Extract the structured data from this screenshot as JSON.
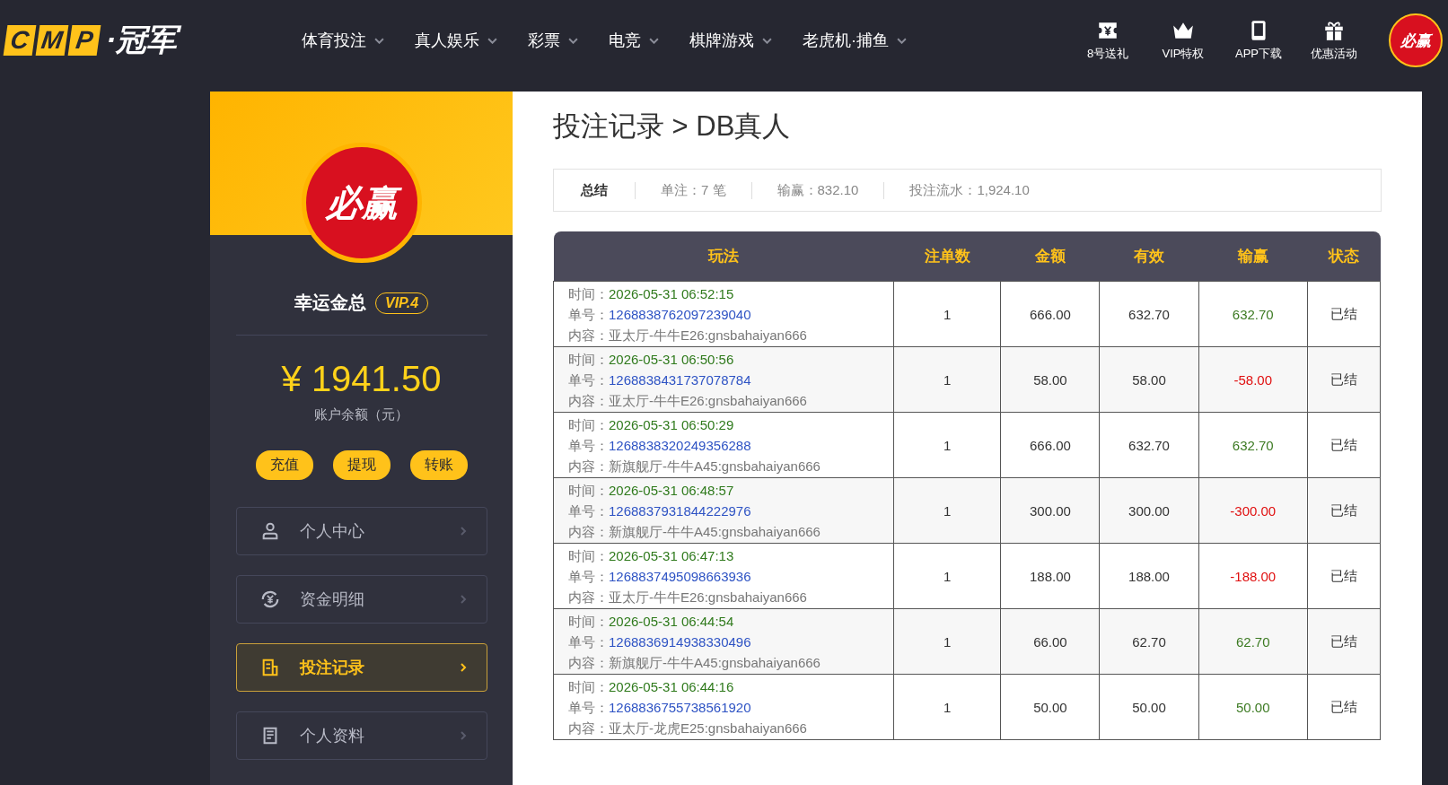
{
  "header": {
    "logo_letters": [
      "C",
      "M",
      "P"
    ],
    "logo_text": "·冠军",
    "nav": [
      {
        "label": "体育投注"
      },
      {
        "label": "真人娱乐"
      },
      {
        "label": "彩票"
      },
      {
        "label": "电竞"
      },
      {
        "label": "棋牌游戏"
      },
      {
        "label": "老虎机·捕鱼"
      }
    ],
    "quick_links": [
      {
        "label": "8号送礼"
      },
      {
        "label": "VIP特权"
      },
      {
        "label": "APP下载"
      },
      {
        "label": "优惠活动"
      }
    ],
    "avatar_text": "必赢"
  },
  "profile": {
    "avatar_text": "必赢",
    "name": "幸运金总",
    "vip": "VIP.4",
    "balance": "¥ 1941.50",
    "balance_label": "账户余额（元）",
    "actions": [
      "充值",
      "提现",
      "转账"
    ]
  },
  "menu": [
    {
      "label": "个人中心",
      "selected": false
    },
    {
      "label": "资金明细",
      "selected": false
    },
    {
      "label": "投注记录",
      "selected": true
    },
    {
      "label": "个人资料",
      "selected": false
    }
  ],
  "page_title": "投注记录 > DB真人",
  "summary": {
    "title": "总结",
    "items": [
      "单注：7 笔",
      "输赢：832.10",
      "投注流水：1,924.10"
    ]
  },
  "table": {
    "columns": [
      "玩法",
      "注单数",
      "金额",
      "有效",
      "输赢",
      "状态"
    ],
    "rows": [
      {
        "time_label": "时间：",
        "time": "2026-05-31 06:52:15",
        "id_label": "单号：",
        "id": "1268838762097239040",
        "content_label": "内容：",
        "content": "亚太厅-牛牛E26:gnsbahaiyan666",
        "count": "1",
        "amount": "666.00",
        "valid": "632.70",
        "result": "632.70",
        "color": "#3c7a22",
        "status": "已结"
      },
      {
        "time_label": "时间：",
        "time": "2026-05-31 06:50:56",
        "id_label": "单号：",
        "id": "1268838431737078784",
        "content_label": "内容：",
        "content": "亚太厅-牛牛E26:gnsbahaiyan666",
        "count": "1",
        "amount": "58.00",
        "valid": "58.00",
        "result": "-58.00",
        "color": "#e01010",
        "status": "已结"
      },
      {
        "time_label": "时间：",
        "time": "2026-05-31 06:50:29",
        "id_label": "单号：",
        "id": "1268838320249356288",
        "content_label": "内容：",
        "content": "新旗舰厅-牛牛A45:gnsbahaiyan666",
        "count": "1",
        "amount": "666.00",
        "valid": "632.70",
        "result": "632.70",
        "color": "#3c7a22",
        "status": "已结"
      },
      {
        "time_label": "时间：",
        "time": "2026-05-31 06:48:57",
        "id_label": "单号：",
        "id": "1268837931844222976",
        "content_label": "内容：",
        "content": "新旗舰厅-牛牛A45:gnsbahaiyan666",
        "count": "1",
        "amount": "300.00",
        "valid": "300.00",
        "result": "-300.00",
        "color": "#e01010",
        "status": "已结"
      },
      {
        "time_label": "时间：",
        "time": "2026-05-31 06:47:13",
        "id_label": "单号：",
        "id": "1268837495098663936",
        "content_label": "内容：",
        "content": "亚太厅-牛牛E26:gnsbahaiyan666",
        "count": "1",
        "amount": "188.00",
        "valid": "188.00",
        "result": "-188.00",
        "color": "#e01010",
        "status": "已结"
      },
      {
        "time_label": "时间：",
        "time": "2026-05-31 06:44:54",
        "id_label": "单号：",
        "id": "1268836914938330496",
        "content_label": "内容：",
        "content": "新旗舰厅-牛牛A45:gnsbahaiyan666",
        "count": "1",
        "amount": "66.00",
        "valid": "62.70",
        "result": "62.70",
        "color": "#3c7a22",
        "status": "已结"
      },
      {
        "time_label": "时间：",
        "time": "2026-05-31 06:44:16",
        "id_label": "单号：",
        "id": "1268836755738561920",
        "content_label": "内容：",
        "content": "亚太厅-龙虎E25:gnsbahaiyan666",
        "count": "1",
        "amount": "50.00",
        "valid": "50.00",
        "result": "50.00",
        "color": "#3c7a22",
        "status": "已结"
      }
    ]
  }
}
